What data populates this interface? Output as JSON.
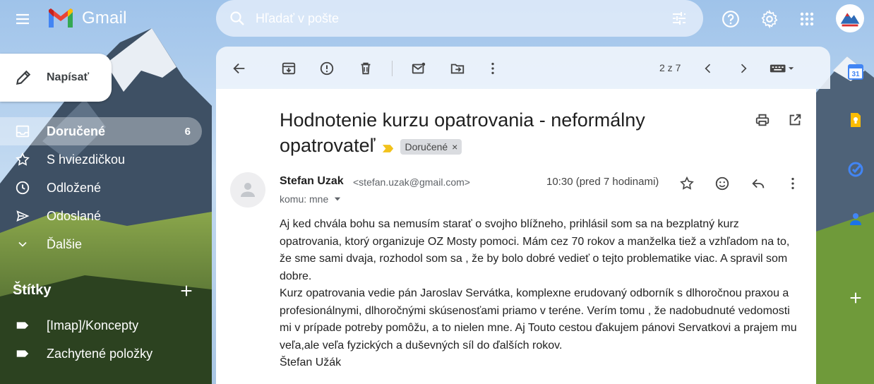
{
  "header": {
    "app_name": "Gmail",
    "search_placeholder": "Hľadať v pošte"
  },
  "compose": {
    "label": "Napísať"
  },
  "nav": {
    "items": [
      {
        "label": "Doručené",
        "count": "6",
        "icon": "inbox-icon"
      },
      {
        "label": "S hviezdičkou",
        "icon": "star-icon"
      },
      {
        "label": "Odložené",
        "icon": "clock-icon"
      },
      {
        "label": "Odoslané",
        "icon": "send-icon"
      },
      {
        "label": "Ďalšie",
        "icon": "chevron-down-icon"
      }
    ]
  },
  "labels": {
    "title": "Štítky",
    "items": [
      {
        "label": "[Imap]/Koncepty"
      },
      {
        "label": "Zachytené položky"
      }
    ]
  },
  "toolbar": {
    "pager": "2 z 7"
  },
  "message": {
    "subject": "Hodnotenie kurzu opatrovania - neformálny opatrovateľ",
    "label_chip": "Doručené",
    "chip_close": "×",
    "sender_name": "Stefan Uzak",
    "sender_email": "<stefan.uzak@gmail.com>",
    "to_line": "komu: mne",
    "time": "10:30 (pred 7 hodinami)",
    "body": [
      "Aj ked chvála bohu sa nemusím starať o svojho blížneho, prihlásil som sa na bezplatný kurz opatrovania, ktorý organizuje OZ Mosty pomoci. Mám cez 70 rokov a manželka tiež a vzhľadom na to, že sme sami dvaja,  rozhodol som sa , že by bolo dobré vedieť o tejto problematike viac. A spravil som dobre.",
      "Kurz opatrovania vedie pán Jaroslav Servátka, komplexne erudovaný odborník s dlhoročnou praxou a profesionálnymi, dlhoročnými skúsenosťami priamo v teréne. Verím tomu , že nadobudnuté vedomosti mi v prípade potreby pomôžu, a to  nielen mne. Aj  Touto cestou ďakujem pánovi Servatkovi a prajem mu veľa,ale veľa fyzických a duševných síl do ďalších rokov.",
      "Štefan Užák"
    ]
  },
  "side_panel": {
    "calendar_day": "31"
  },
  "colors": {
    "gmail_red": "#ea4335",
    "gmail_blue": "#4285f4",
    "gmail_green": "#34a853",
    "gmail_yellow": "#fbbc04",
    "important_marker": "#f2c21b"
  }
}
